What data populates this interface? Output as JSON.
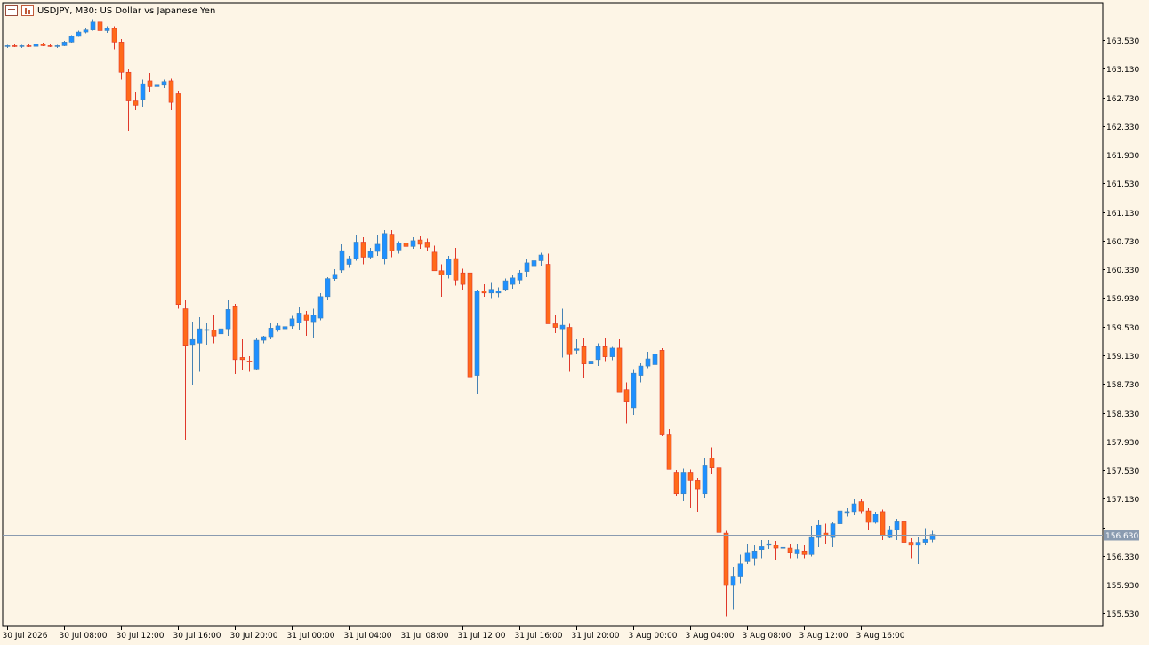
{
  "window": {
    "symbol": "USDJPY",
    "timeframe": "M30",
    "description": "US Dollar vs Japanese Yen",
    "title_text": "USDJPY, M30:  US Dollar vs Japanese Yen"
  },
  "colors": {
    "background": "#fdf5e6",
    "bull_body": "#1e90ff",
    "bull_wick": "#4682b4",
    "bear_body": "#ff6a1a",
    "bear_wick": "#e0382a",
    "price_line": "#8a9bb0",
    "price_tag_bg": "#8a9bb0",
    "axis": "#000000"
  },
  "icons": [
    "list-icon",
    "bar-chart-icon"
  ],
  "chart_data": {
    "type": "candlestick",
    "ylim": [
      155.35,
      164.05
    ],
    "y_ticks": [
      "163.530",
      "163.130",
      "162.730",
      "162.330",
      "161.930",
      "161.530",
      "161.130",
      "160.730",
      "160.330",
      "159.930",
      "159.530",
      "159.130",
      "158.730",
      "158.330",
      "157.930",
      "157.530",
      "157.130",
      "156.730",
      "156.330",
      "155.930",
      "155.530"
    ],
    "x_ticks": [
      {
        "index": 0,
        "label": "30 Jul 2026"
      },
      {
        "index": 8,
        "label": "30 Jul 08:00"
      },
      {
        "index": 16,
        "label": "30 Jul 12:00"
      },
      {
        "index": 24,
        "label": "30 Jul 16:00"
      },
      {
        "index": 32,
        "label": "30 Jul 20:00"
      },
      {
        "index": 40,
        "label": "31 Jul 00:00"
      },
      {
        "index": 48,
        "label": "31 Jul 04:00"
      },
      {
        "index": 56,
        "label": "31 Jul 08:00"
      },
      {
        "index": 64,
        "label": "31 Jul 12:00"
      },
      {
        "index": 72,
        "label": "31 Jul 16:00"
      },
      {
        "index": 80,
        "label": "31 Jul 20:00"
      },
      {
        "index": 88,
        "label": "3 Aug 00:00"
      },
      {
        "index": 96,
        "label": "3 Aug 04:00"
      },
      {
        "index": 104,
        "label": "3 Aug 08:00"
      },
      {
        "index": 112,
        "label": "3 Aug 12:00"
      },
      {
        "index": 120,
        "label": "3 Aug 16:00"
      }
    ],
    "current_price": "156.630",
    "current_price_value": 156.63,
    "candles": [
      [
        163.44,
        163.46,
        163.42,
        163.45
      ],
      [
        163.45,
        163.47,
        163.43,
        163.44
      ],
      [
        163.44,
        163.46,
        163.42,
        163.45
      ],
      [
        163.45,
        163.47,
        163.43,
        163.44
      ],
      [
        163.44,
        163.48,
        163.43,
        163.47
      ],
      [
        163.47,
        163.49,
        163.44,
        163.45
      ],
      [
        163.45,
        163.47,
        163.43,
        163.44
      ],
      [
        163.44,
        163.46,
        163.42,
        163.45
      ],
      [
        163.45,
        163.52,
        163.44,
        163.5
      ],
      [
        163.5,
        163.6,
        163.49,
        163.58
      ],
      [
        163.58,
        163.66,
        163.57,
        163.64
      ],
      [
        163.64,
        163.7,
        163.62,
        163.67
      ],
      [
        163.67,
        163.82,
        163.66,
        163.78
      ],
      [
        163.78,
        163.8,
        163.6,
        163.66
      ],
      [
        163.66,
        163.72,
        163.63,
        163.69
      ],
      [
        163.69,
        163.72,
        163.4,
        163.5
      ],
      [
        163.5,
        163.54,
        162.98,
        163.08
      ],
      [
        163.08,
        163.12,
        162.25,
        162.68
      ],
      [
        162.68,
        162.8,
        162.55,
        162.62
      ],
      [
        162.7,
        162.98,
        162.6,
        162.92
      ],
      [
        162.96,
        163.07,
        162.8,
        162.88
      ],
      [
        162.88,
        162.92,
        162.85,
        162.9
      ],
      [
        162.9,
        162.98,
        162.86,
        162.95
      ],
      [
        162.96,
        162.99,
        162.55,
        162.66
      ],
      [
        162.78,
        162.82,
        159.78,
        159.84
      ],
      [
        159.78,
        159.9,
        157.95,
        159.27
      ],
      [
        159.28,
        159.6,
        158.72,
        159.35
      ],
      [
        159.3,
        159.66,
        158.9,
        159.5
      ],
      [
        159.48,
        159.58,
        159.28,
        159.49
      ],
      [
        159.48,
        159.7,
        159.3,
        159.4
      ],
      [
        159.43,
        159.58,
        159.4,
        159.5
      ],
      [
        159.5,
        159.9,
        159.4,
        159.77
      ],
      [
        159.82,
        159.85,
        158.87,
        159.07
      ],
      [
        159.1,
        159.35,
        158.93,
        159.07
      ],
      [
        159.05,
        159.12,
        158.9,
        159.04
      ],
      [
        158.94,
        159.37,
        158.92,
        159.34
      ],
      [
        159.34,
        159.4,
        159.3,
        159.39
      ],
      [
        159.39,
        159.58,
        159.35,
        159.51
      ],
      [
        159.48,
        159.58,
        159.46,
        159.54
      ],
      [
        159.5,
        159.65,
        159.45,
        159.53
      ],
      [
        159.54,
        159.68,
        159.5,
        159.64
      ],
      [
        159.58,
        159.8,
        159.48,
        159.72
      ],
      [
        159.7,
        159.75,
        159.4,
        159.62
      ],
      [
        159.6,
        159.78,
        159.38,
        159.69
      ],
      [
        159.65,
        160.0,
        159.62,
        159.95
      ],
      [
        159.95,
        160.22,
        159.9,
        160.2
      ],
      [
        160.2,
        160.33,
        160.17,
        160.26
      ],
      [
        160.32,
        160.68,
        160.28,
        160.59
      ],
      [
        160.4,
        160.52,
        160.35,
        160.48
      ],
      [
        160.48,
        160.8,
        160.45,
        160.71
      ],
      [
        160.71,
        160.78,
        160.4,
        160.5
      ],
      [
        160.5,
        160.63,
        160.48,
        160.58
      ],
      [
        160.58,
        160.8,
        160.52,
        160.68
      ],
      [
        160.48,
        160.88,
        160.4,
        160.83
      ],
      [
        160.82,
        160.88,
        160.5,
        160.59
      ],
      [
        160.6,
        160.72,
        160.55,
        160.7
      ],
      [
        160.7,
        160.75,
        160.58,
        160.65
      ],
      [
        160.65,
        160.78,
        160.62,
        160.73
      ],
      [
        160.74,
        160.79,
        160.62,
        160.68
      ],
      [
        160.71,
        160.76,
        160.58,
        160.64
      ],
      [
        160.57,
        160.66,
        160.32,
        160.31
      ],
      [
        160.31,
        160.4,
        159.95,
        160.25
      ],
      [
        160.25,
        160.52,
        160.2,
        160.47
      ],
      [
        160.48,
        160.63,
        160.1,
        160.18
      ],
      [
        160.28,
        160.34,
        160.05,
        160.12
      ],
      [
        160.28,
        160.32,
        158.58,
        158.83
      ],
      [
        158.85,
        160.05,
        158.6,
        160.03
      ],
      [
        160.03,
        160.12,
        159.95,
        160.0
      ],
      [
        160.0,
        160.15,
        159.93,
        160.05
      ],
      [
        160.0,
        160.08,
        159.94,
        160.03
      ],
      [
        160.05,
        160.2,
        160.02,
        160.17
      ],
      [
        160.12,
        160.25,
        160.06,
        160.21
      ],
      [
        160.18,
        160.32,
        160.12,
        160.28
      ],
      [
        160.3,
        160.48,
        160.22,
        160.42
      ],
      [
        160.38,
        160.5,
        160.3,
        160.45
      ],
      [
        160.45,
        160.56,
        160.38,
        160.53
      ],
      [
        160.4,
        160.55,
        159.58,
        159.57
      ],
      [
        159.57,
        159.7,
        159.44,
        159.52
      ],
      [
        159.5,
        159.78,
        159.1,
        159.55
      ],
      [
        159.52,
        159.57,
        158.9,
        159.14
      ],
      [
        159.2,
        159.35,
        159.15,
        159.22
      ],
      [
        159.25,
        159.38,
        158.82,
        159.01
      ],
      [
        159.01,
        159.1,
        158.95,
        159.05
      ],
      [
        159.07,
        159.3,
        158.98,
        159.25
      ],
      [
        159.25,
        159.38,
        159.05,
        159.11
      ],
      [
        159.11,
        159.25,
        159.06,
        159.23
      ],
      [
        159.23,
        159.35,
        158.75,
        158.62
      ],
      [
        158.65,
        158.75,
        158.18,
        158.49
      ],
      [
        158.4,
        158.94,
        158.3,
        158.88
      ],
      [
        158.85,
        159.02,
        158.75,
        158.98
      ],
      [
        158.98,
        159.18,
        158.95,
        159.08
      ],
      [
        159.0,
        159.25,
        158.95,
        159.15
      ],
      [
        159.2,
        159.23,
        158.0,
        158.02
      ],
      [
        158.02,
        158.1,
        157.55,
        157.54
      ],
      [
        157.5,
        157.53,
        157.17,
        157.2
      ],
      [
        157.2,
        157.55,
        157.1,
        157.5
      ],
      [
        157.5,
        157.54,
        157.0,
        157.39
      ],
      [
        157.39,
        157.42,
        156.95,
        157.27
      ],
      [
        157.2,
        157.7,
        157.15,
        157.6
      ],
      [
        157.7,
        157.85,
        157.48,
        157.56
      ],
      [
        157.56,
        157.87,
        156.63,
        156.66
      ],
      [
        156.65,
        156.68,
        155.49,
        155.92
      ],
      [
        155.92,
        156.18,
        155.58,
        156.05
      ],
      [
        156.05,
        156.35,
        155.95,
        156.22
      ],
      [
        156.25,
        156.5,
        156.22,
        156.38
      ],
      [
        156.3,
        156.48,
        156.2,
        156.4
      ],
      [
        156.42,
        156.55,
        156.3,
        156.46
      ],
      [
        156.48,
        156.55,
        156.43,
        156.5
      ],
      [
        156.48,
        156.54,
        156.28,
        156.44
      ],
      [
        156.44,
        156.52,
        156.38,
        156.45
      ],
      [
        156.44,
        156.5,
        156.3,
        156.38
      ],
      [
        156.36,
        156.5,
        156.3,
        156.42
      ],
      [
        156.4,
        156.48,
        156.3,
        156.35
      ],
      [
        156.35,
        156.75,
        156.32,
        156.6
      ],
      [
        156.6,
        156.84,
        156.45,
        156.76
      ],
      [
        156.65,
        156.78,
        156.5,
        156.62
      ],
      [
        156.6,
        156.8,
        156.45,
        156.78
      ],
      [
        156.78,
        157.0,
        156.73,
        156.96
      ],
      [
        156.94,
        157.0,
        156.88,
        156.95
      ],
      [
        156.95,
        157.12,
        156.9,
        157.06
      ],
      [
        157.09,
        157.12,
        156.93,
        156.96
      ],
      [
        156.96,
        157.0,
        156.7,
        156.8
      ],
      [
        156.8,
        156.95,
        156.78,
        156.92
      ],
      [
        156.95,
        156.98,
        156.55,
        156.62
      ],
      [
        156.6,
        156.75,
        156.58,
        156.7
      ],
      [
        156.7,
        156.85,
        156.55,
        156.82
      ],
      [
        156.82,
        156.9,
        156.42,
        156.52
      ],
      [
        156.52,
        156.58,
        156.3,
        156.48
      ],
      [
        156.48,
        156.6,
        156.22,
        156.52
      ],
      [
        156.52,
        156.72,
        156.48,
        156.56
      ],
      [
        156.56,
        156.68,
        156.52,
        156.63
      ]
    ]
  }
}
